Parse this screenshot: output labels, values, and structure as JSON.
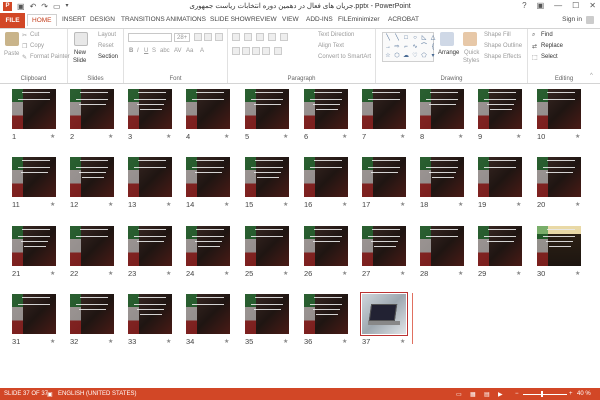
{
  "window": {
    "title": "جریان های فعال در دهمین دوره انتخابات ریاست جمهوری.pptx - PowerPoint",
    "controls": [
      "?",
      "▣",
      "—",
      "☐",
      "✕"
    ]
  },
  "ribbon_tabs": [
    "FILE",
    "HOME",
    "INSERT",
    "DESIGN",
    "TRANSITIONS",
    "ANIMATIONS",
    "SLIDE SHOW",
    "REVIEW",
    "VIEW",
    "ADD-INS",
    "FILEminimizer",
    "ACROBAT"
  ],
  "sign_in": "Sign in",
  "clipboard": {
    "paste": "Paste",
    "cut": "Cut",
    "copy": "Copy",
    "format_painter": "Format Painter",
    "label": "Clipboard"
  },
  "slides_group": {
    "new_slide": "New",
    "new_slide2": "Slide",
    "layout": "Layout",
    "reset": "Reset",
    "section": "Section",
    "label": "Slides"
  },
  "font_group": {
    "font_name": "",
    "font_size": "28+",
    "label": "Font"
  },
  "paragraph_group": {
    "text_direction": "Text Direction",
    "align_text": "Align Text",
    "convert_smartart": "Convert to SmartArt",
    "label": "Paragraph"
  },
  "drawing_group": {
    "arrange": "Arrange",
    "quick_styles": "Quick",
    "quick_styles2": "Styles",
    "shape_fill": "Shape Fill",
    "shape_outline": "Shape Outline",
    "shape_effects": "Shape Effects",
    "label": "Drawing"
  },
  "editing_group": {
    "find": "Find",
    "replace": "Replace",
    "select": "Select",
    "label": "Editing"
  },
  "slides": [
    "1",
    "2",
    "3",
    "4",
    "5",
    "6",
    "7",
    "8",
    "9",
    "10",
    "11",
    "12",
    "13",
    "14",
    "15",
    "16",
    "17",
    "18",
    "19",
    "20",
    "21",
    "22",
    "23",
    "24",
    "25",
    "26",
    "27",
    "28",
    "29",
    "30",
    "31",
    "32",
    "33",
    "34",
    "35",
    "36",
    "37"
  ],
  "star": "★",
  "status": {
    "slide_info": "SLIDE 37 OF 37",
    "language": "ENGLISH (UNITED STATES)",
    "zoom": "40 %",
    "zoom_minus": "−",
    "zoom_plus": "+"
  }
}
